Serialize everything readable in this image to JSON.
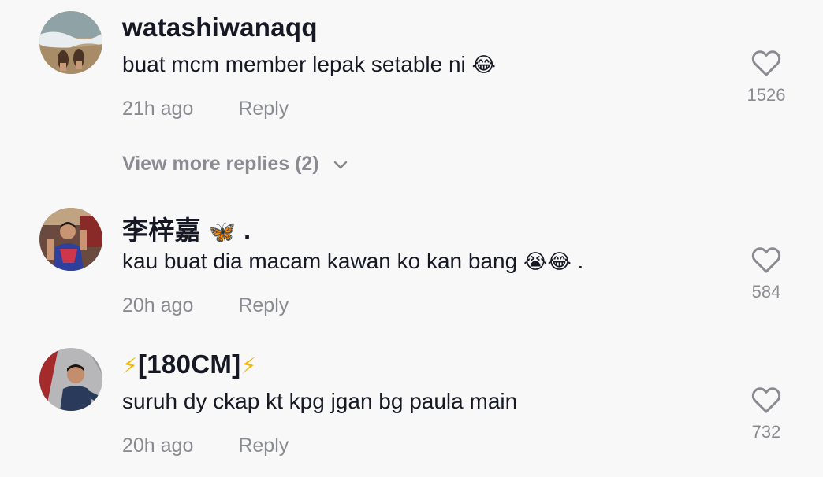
{
  "comments": [
    {
      "username": "watashiwanaqq",
      "username_emoji": "",
      "text": "buat mcm member lepak setable ni",
      "text_emoji": "😂",
      "time": "21h ago",
      "reply_label": "Reply",
      "likes": "1526"
    },
    {
      "username": "李梓嘉",
      "username_emoji": "🦋",
      "username_suffix": ".",
      "text": "kau buat dia macam kawan ko kan bang",
      "text_emoji": "😭😂",
      "text_suffix": ".",
      "time": "20h ago",
      "reply_label": "Reply",
      "likes": "584"
    },
    {
      "username": "[180CM]",
      "username_emoji_pre": "⚡",
      "username_emoji_post": "⚡",
      "text": "suruh dy ckap kt kpg jgan bg paula main",
      "time": "20h ago",
      "reply_label": "Reply",
      "likes": "732"
    }
  ],
  "view_more_replies": "View more replies (2)",
  "icons": {
    "like": "heart-outline-icon",
    "expand": "chevron-down-icon"
  },
  "colors": {
    "background": "#f8f8f8",
    "primary_text": "#161823",
    "secondary_text": "#8a8b91"
  }
}
